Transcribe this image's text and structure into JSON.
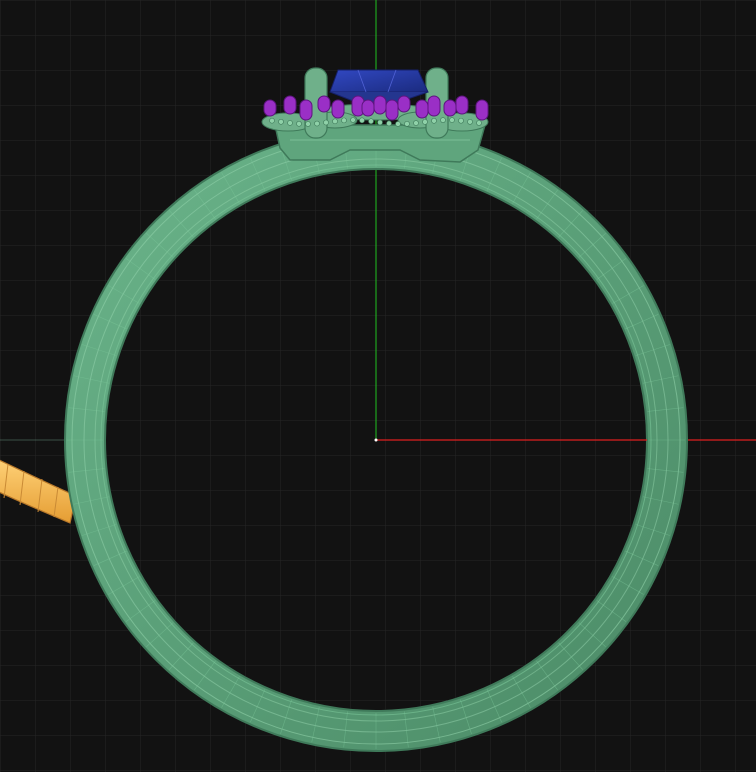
{
  "app": {
    "view": "front-orthographic"
  },
  "colors": {
    "background": "#121212",
    "grid_minor": "#262626",
    "grid_major": "#303030",
    "axis_x": "#e02020",
    "axis_y": "#20c020",
    "axis_z_ghost": "#7fb89a",
    "ring_body": "#5fa57d",
    "ring_edge": "#3f7a5a",
    "ring_highlight": "#8fd1a8",
    "center_stone": "#2a3fa8",
    "accent_stones": "#9a2fc6",
    "prongs": "#6fb08a",
    "secondary_object": "#f3b34a"
  },
  "icons": {
    "center_stone": "sapphire-stone-icon",
    "accent_stones": "melee-stone-icon",
    "origin": "origin-marker-icon"
  }
}
